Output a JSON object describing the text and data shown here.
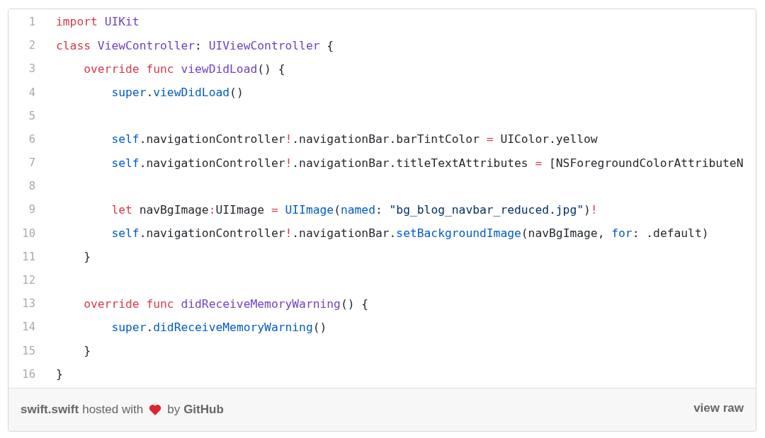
{
  "code": {
    "lines": [
      {
        "number": "1",
        "tokens": [
          {
            "kind": "keyword",
            "text": "import "
          },
          {
            "kind": "type",
            "text": "UIKit"
          }
        ]
      },
      {
        "number": "2",
        "tokens": [
          {
            "kind": "keyword",
            "text": "class "
          },
          {
            "kind": "type",
            "text": "ViewController"
          },
          {
            "kind": "plain",
            "text": ": "
          },
          {
            "kind": "type",
            "text": "UIViewController"
          },
          {
            "kind": "plain",
            "text": " {"
          }
        ]
      },
      {
        "number": "3",
        "tokens": [
          {
            "kind": "keyword",
            "text": "    override func "
          },
          {
            "kind": "type",
            "text": "viewDidLoad"
          },
          {
            "kind": "plain",
            "text": "() {"
          }
        ]
      },
      {
        "number": "4",
        "tokens": [
          {
            "kind": "call",
            "text": "        super"
          },
          {
            "kind": "plain",
            "text": "."
          },
          {
            "kind": "call",
            "text": "viewDidLoad"
          },
          {
            "kind": "plain",
            "text": "()"
          }
        ]
      },
      {
        "number": "5"
      },
      {
        "number": "6",
        "tokens": [
          {
            "kind": "call",
            "text": "        self"
          },
          {
            "kind": "plain",
            "text": ".navigationController"
          },
          {
            "kind": "keyword",
            "text": "!"
          },
          {
            "kind": "plain",
            "text": ".navigationBar.barTintColor "
          },
          {
            "kind": "keyword",
            "text": "="
          },
          {
            "kind": "plain",
            "text": " UIColor.yellow"
          }
        ]
      },
      {
        "number": "7",
        "tokens": [
          {
            "kind": "call",
            "text": "        self"
          },
          {
            "kind": "plain",
            "text": ".navigationController"
          },
          {
            "kind": "keyword",
            "text": "!"
          },
          {
            "kind": "plain",
            "text": ".navigationBar.titleTextAttributes "
          },
          {
            "kind": "keyword",
            "text": "="
          },
          {
            "kind": "plain",
            "text": " [NSForegroundColorAttributeN"
          }
        ]
      },
      {
        "number": "8"
      },
      {
        "number": "9",
        "tokens": [
          {
            "kind": "keyword",
            "text": "        let"
          },
          {
            "kind": "plain",
            "text": " navBgImage"
          },
          {
            "kind": "keyword",
            "text": ":"
          },
          {
            "kind": "plain",
            "text": "UIImage "
          },
          {
            "kind": "keyword",
            "text": "= "
          },
          {
            "kind": "call",
            "text": "UIImage"
          },
          {
            "kind": "plain",
            "text": "("
          },
          {
            "kind": "call",
            "text": "named"
          },
          {
            "kind": "plain",
            "text": ": "
          },
          {
            "kind": "string",
            "text": "\"bg_blog_navbar_reduced.jpg\""
          },
          {
            "kind": "plain",
            "text": ")"
          },
          {
            "kind": "keyword",
            "text": "!"
          }
        ]
      },
      {
        "number": "10",
        "tokens": [
          {
            "kind": "call",
            "text": "        self"
          },
          {
            "kind": "plain",
            "text": ".navigationController"
          },
          {
            "kind": "keyword",
            "text": "!"
          },
          {
            "kind": "plain",
            "text": ".navigationBar."
          },
          {
            "kind": "call",
            "text": "setBackgroundImage"
          },
          {
            "kind": "plain",
            "text": "(navBgImage, "
          },
          {
            "kind": "call",
            "text": "for"
          },
          {
            "kind": "plain",
            "text": ": .default)"
          }
        ]
      },
      {
        "number": "11",
        "tokens": [
          {
            "kind": "plain",
            "text": "    }"
          }
        ]
      },
      {
        "number": "12"
      },
      {
        "number": "13",
        "tokens": [
          {
            "kind": "keyword",
            "text": "    override func "
          },
          {
            "kind": "type",
            "text": "didReceiveMemoryWarning"
          },
          {
            "kind": "plain",
            "text": "() {"
          }
        ]
      },
      {
        "number": "14",
        "tokens": [
          {
            "kind": "call",
            "text": "        super"
          },
          {
            "kind": "plain",
            "text": "."
          },
          {
            "kind": "call",
            "text": "didReceiveMemoryWarning"
          },
          {
            "kind": "plain",
            "text": "()"
          }
        ]
      },
      {
        "number": "15",
        "tokens": [
          {
            "kind": "plain",
            "text": "    }"
          }
        ]
      },
      {
        "number": "16",
        "tokens": [
          {
            "kind": "plain",
            "text": "}"
          }
        ]
      }
    ]
  },
  "footer": {
    "file_link": "swift.swift",
    "hosted_text": "hosted with",
    "by_text": "by",
    "host_link": "GitHub",
    "raw_link": "view raw"
  }
}
